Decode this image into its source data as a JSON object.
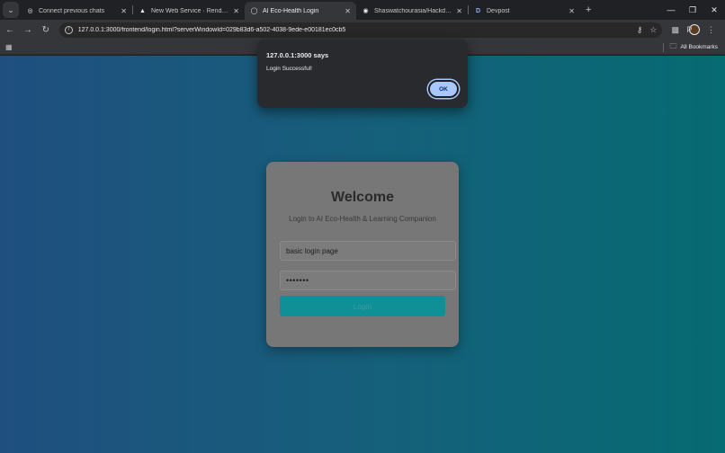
{
  "tabs": [
    {
      "title": "Connect previous chats",
      "icon": "chat-icon",
      "active": false
    },
    {
      "title": "New Web Service · Render Da",
      "icon": "render-icon",
      "active": false
    },
    {
      "title": "AI Eco-Health Login",
      "icon": "globe-icon",
      "active": true
    },
    {
      "title": "Shaswatchourasia/Hackday_sh",
      "icon": "github-icon",
      "active": false
    },
    {
      "title": "Devpost",
      "icon": "devpost-icon",
      "active": false
    }
  ],
  "omnibox": {
    "url": "127.0.0.1:3000/frontend/login.html?serverWindowId=029b83d6-a502-4038-9ede-e00181ec0cb5"
  },
  "bookmarks": {
    "all_bookmarks_label": "All Bookmarks"
  },
  "profile": {
    "initial": "P"
  },
  "dialog": {
    "title": "127.0.0.1:3000 says",
    "message": "Login Successful!",
    "ok_label": "OK"
  },
  "login": {
    "heading": "Welcome",
    "subtitle": "Login to AI Eco-Health & Learning Companion",
    "username_value": "basic login page",
    "password_value": "•••••••",
    "button_label": "Login"
  },
  "colors": {
    "accent_button": "#0f8f96",
    "dialog_ok": "#a8c7fa",
    "gradient_start": "#1f4f7f",
    "gradient_end": "#066b72"
  }
}
